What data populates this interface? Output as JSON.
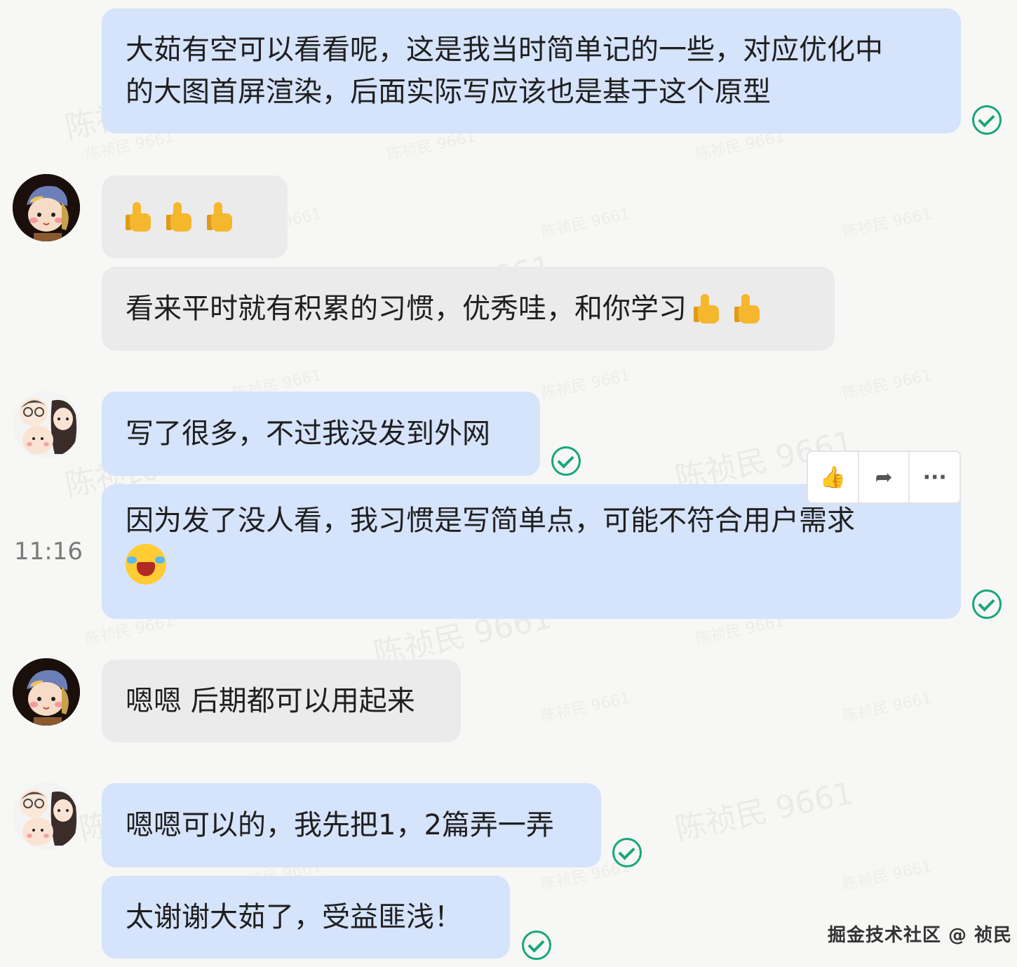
{
  "messages": [
    {
      "text": "大茹有空可以看看呢，这是我当时简单记的一些，对应优化中\n的大图首屏渲染，后面实际写应该也是基于这个原型"
    },
    {
      "text": ""
    },
    {
      "text": "看来平时就有积累的习惯，优秀哇，和你学习"
    },
    {
      "text": "写了很多，不过我没发到外网"
    },
    {
      "text": "因为发了没人看，我习惯是写简单点，可能不符合用户需求"
    },
    {
      "text": "嗯嗯 后期都可以用起来"
    },
    {
      "text": "嗯嗯可以的，我先把1，2篇弄一弄"
    },
    {
      "text": "太谢谢大茹了，受益匪浅！"
    }
  ],
  "timestamp": "11:16",
  "toolbar": {
    "like_icon": "👍",
    "forward_icon": "➦",
    "more_icon": "···"
  },
  "watermark": "陈祯民 9661",
  "footer": "掘金技术社区 @ 祯民",
  "colors": {
    "my_bubble": "#d5e3fb",
    "other_bubble": "#ebebeb",
    "read_check": "#18a779"
  }
}
